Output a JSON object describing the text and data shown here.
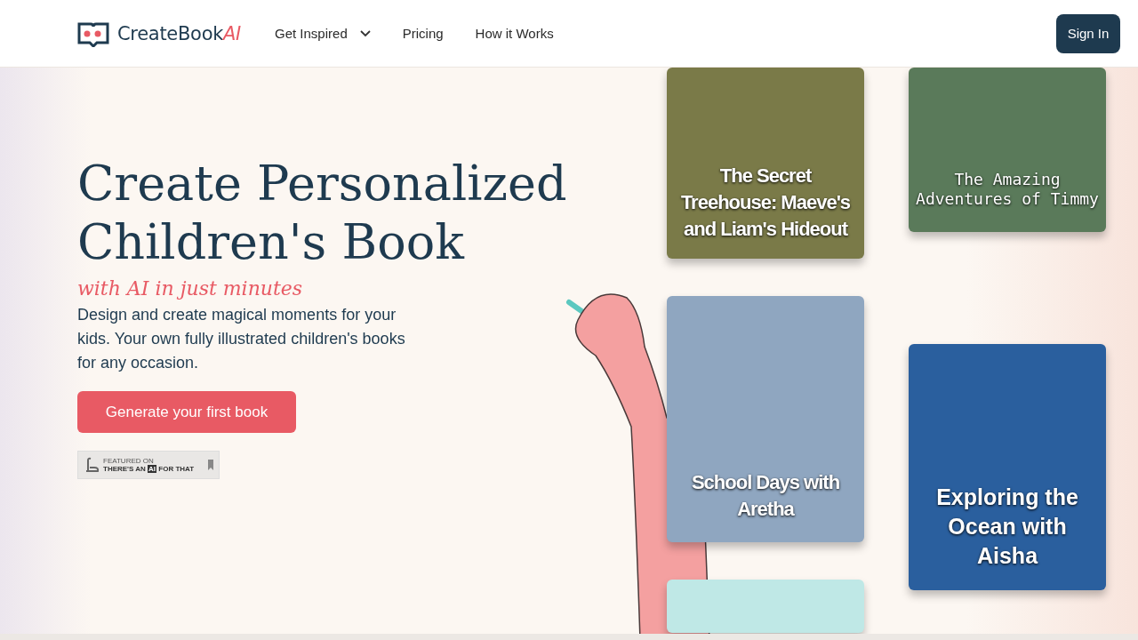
{
  "header": {
    "logo": {
      "word": "CreateBook",
      "accent": "AI"
    },
    "nav": [
      {
        "label": "Get Inspired",
        "dropdown": true
      },
      {
        "label": "Pricing",
        "dropdown": false
      },
      {
        "label": "How it Works",
        "dropdown": false
      }
    ],
    "sign_in": "Sign In"
  },
  "hero": {
    "title": "Create Personalized Children's Book",
    "tagline": "with AI in just minutes",
    "description": "Design and create magical moments for your kids. Your own  fully illustrated children's books for any occasion.",
    "cta": "Generate your first book",
    "badge": {
      "small": "FEATURED ON",
      "main": "THERE'S AN",
      "boxed": "AI",
      "tail": "FOR THAT"
    }
  },
  "books": [
    [
      {
        "title": "The Secret Treehouse: Maeve's and Liam's Hideout",
        "color": "#7a7a48"
      },
      {
        "title": "School Days with Aretha",
        "color": "#8fa6c0"
      },
      {
        "color": "#bfe8e6"
      }
    ],
    [
      {
        "title": "The Amazing Adventures of Timmy",
        "color": "#5a7a5a"
      },
      {
        "title": "Exploring the Ocean with Aisha",
        "color": "#2a5f9e"
      }
    ]
  ]
}
